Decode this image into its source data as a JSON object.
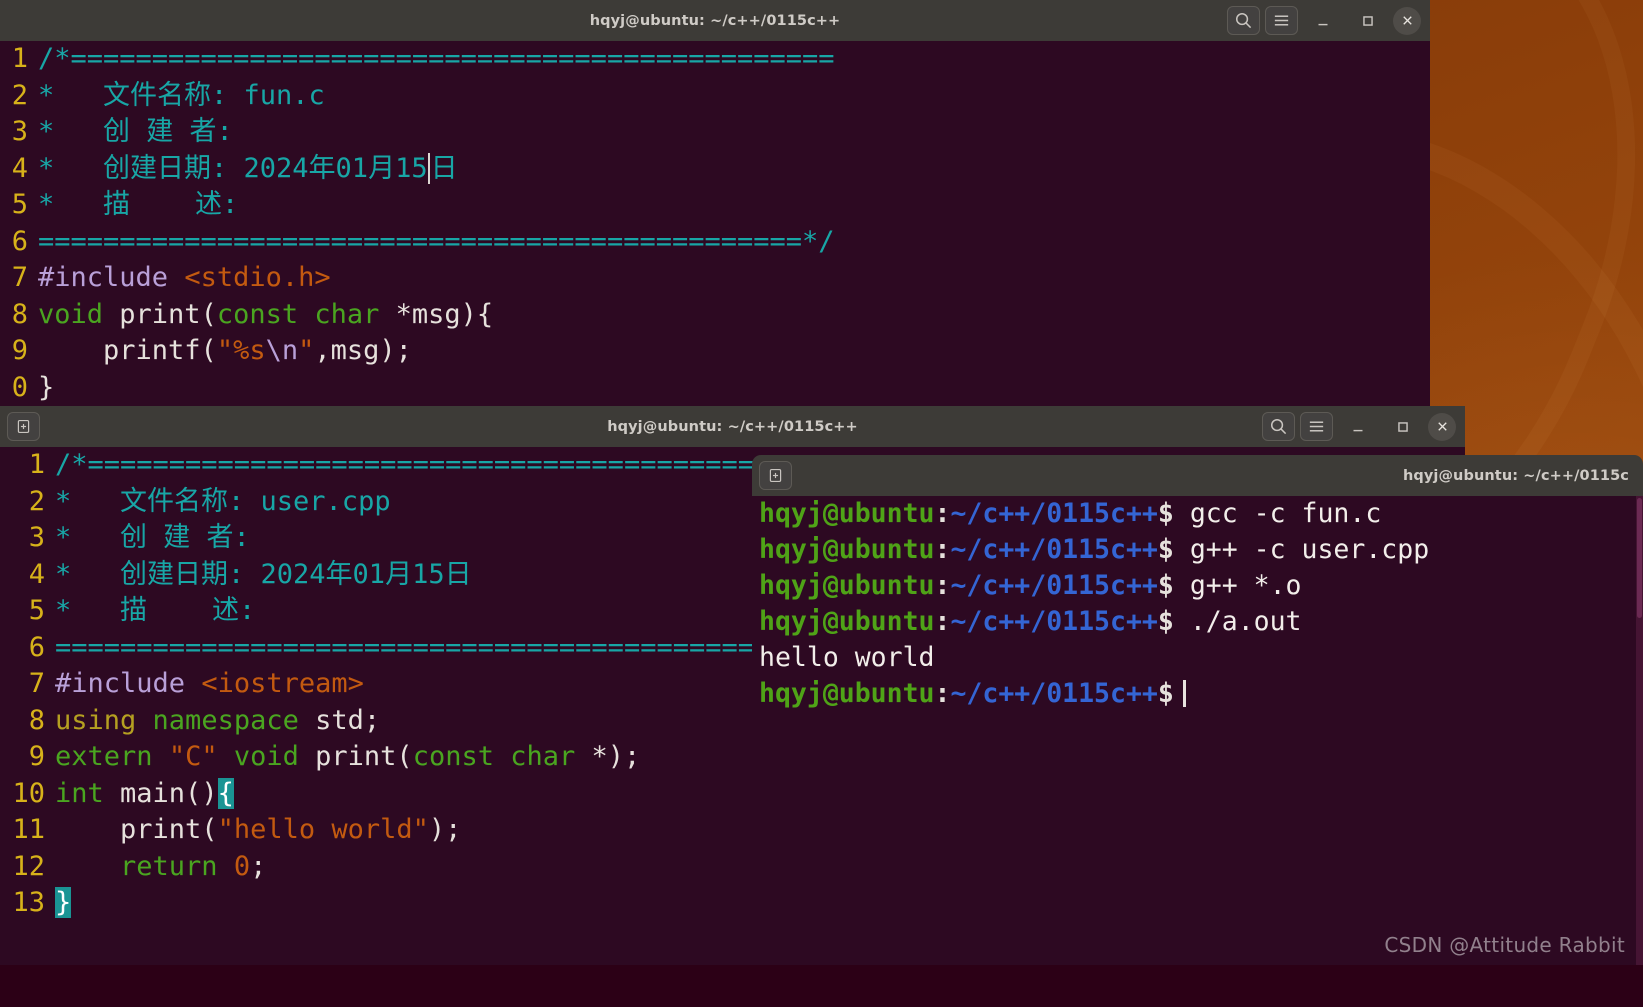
{
  "desktop": {
    "background_color": "#8d3f0a"
  },
  "watermark": {
    "text": "CSDN @Attitude Rabbit"
  },
  "windows": {
    "fun_editor": {
      "title": "hqyj@ubuntu: ~/c++/0115c++",
      "titlebar_buttons": [
        {
          "name": "search",
          "label": "search-icon"
        },
        {
          "name": "menu",
          "label": "hamburger-icon"
        },
        {
          "name": "minimize",
          "label": "minimize-icon"
        },
        {
          "name": "maximize",
          "label": "maximize-icon"
        },
        {
          "name": "close",
          "label": "close-icon"
        }
      ],
      "filename": "fun.c",
      "background_color": "#2d0922",
      "lines": [
        {
          "no": "1",
          "text": "/*==============================================="
        },
        {
          "no": "2",
          "text": "*   文件名称: fun.c"
        },
        {
          "no": "3",
          "text": "*   创 建 者:"
        },
        {
          "no": "4",
          "text": "*   创建日期: 2024年01月15日"
        },
        {
          "no": "5",
          "text": "*   描    述:"
        },
        {
          "no": "6",
          "text": "===============================================*/"
        },
        {
          "no": "7",
          "text": "#include <stdio.h>"
        },
        {
          "no": "8",
          "text": "void print(const char *msg){"
        },
        {
          "no": "9",
          "text": "    printf(\"%s\\n\",msg);"
        },
        {
          "no": "0",
          "text": "}"
        }
      ]
    },
    "user_editor": {
      "title": "hqyj@ubuntu: ~/c++/0115c++",
      "new_tab_label": "+",
      "titlebar_buttons": [
        {
          "name": "search",
          "label": "search-icon"
        },
        {
          "name": "menu",
          "label": "hamburger-icon"
        },
        {
          "name": "minimize",
          "label": "minimize-icon"
        },
        {
          "name": "maximize",
          "label": "maximize-icon"
        },
        {
          "name": "close",
          "label": "close-icon"
        }
      ],
      "filename": "user.cpp",
      "background_color": "#2d0922",
      "lines": [
        {
          "no": "1",
          "text": "/*================================="
        },
        {
          "no": "2",
          "text": "*   文件名称: user.cpp"
        },
        {
          "no": "3",
          "text": "*   创 建 者:"
        },
        {
          "no": "4",
          "text": "*   创建日期: 2024年01月15日"
        },
        {
          "no": "5",
          "text": "*   描    述:"
        },
        {
          "no": "6",
          "text": "================================="
        },
        {
          "no": "7",
          "text": "#include <iostream>"
        },
        {
          "no": "8",
          "text": "using namespace std;"
        },
        {
          "no": "9",
          "text": "extern \"C\" void print(const char *);"
        },
        {
          "no": "10",
          "text": "int main(){"
        },
        {
          "no": "11",
          "text": "    print(\"hello world\");"
        },
        {
          "no": "12",
          "text": "    return 0;"
        },
        {
          "no": "13",
          "text": "}"
        }
      ]
    },
    "terminal": {
      "title": "hqyj@ubuntu: ~/c++/0115c",
      "new_tab_label": "+",
      "background_color": "#2d0922",
      "prompt": {
        "user_host": "hqyj@ubuntu",
        "colon": ":",
        "path": "~/c++/0115c++",
        "symbol": "$"
      },
      "session": [
        {
          "type": "command",
          "text": "gcc -c fun.c"
        },
        {
          "type": "command",
          "text": "g++ -c user.cpp"
        },
        {
          "type": "command",
          "text": "g++ *.o"
        },
        {
          "type": "command",
          "text": "./a.out"
        },
        {
          "type": "output",
          "text": "hello world"
        },
        {
          "type": "prompt_only",
          "text": ""
        }
      ]
    }
  },
  "colors": {
    "comment": "#18a6a6",
    "line_number": "#d7b21a",
    "preprocessor": "#b9a0d8",
    "string": "#c35a10",
    "keyword": "#4aa520",
    "plain": "#e6e1dc",
    "prompt_user": "#4fa317",
    "prompt_path": "#3465d4",
    "brace_highlight": "#1a9494"
  }
}
